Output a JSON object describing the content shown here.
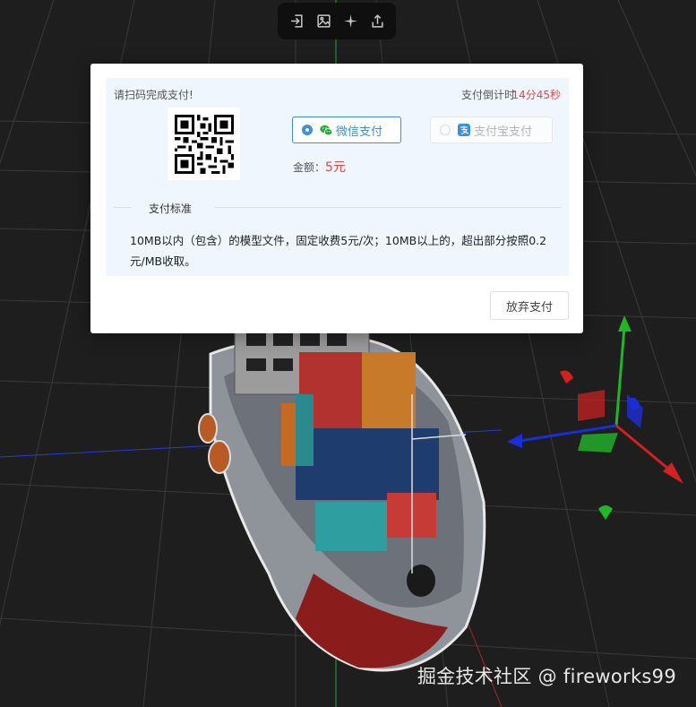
{
  "toolbar": {
    "icons": [
      "import-icon",
      "image-icon",
      "crosshair-icon",
      "export-icon"
    ]
  },
  "dialog": {
    "scan_prompt": "请扫码完成支付!",
    "countdown_label": "支付倒计时",
    "countdown_value": "14分45秒",
    "options": {
      "wechat": {
        "label": "微信支付",
        "selected": true
      },
      "alipay": {
        "label": "支付宝支付",
        "selected": false
      }
    },
    "amount_label": "金额：",
    "amount_value": "5元",
    "standard_title": "支付标准",
    "standard_text": "10MB以内（包含）的模型文件，固定收费5元/次；10MB以上的，超出部分按照0.2元/MB收取。",
    "abandon_label": "放弃支付"
  },
  "watermark": "掘金技术社区 @ fireworks99",
  "colors": {
    "accent": "#3d8fe0",
    "price": "#e5473f",
    "panel_bg": "#f0f6fe",
    "viewport_bg": "#1e1e1e"
  }
}
